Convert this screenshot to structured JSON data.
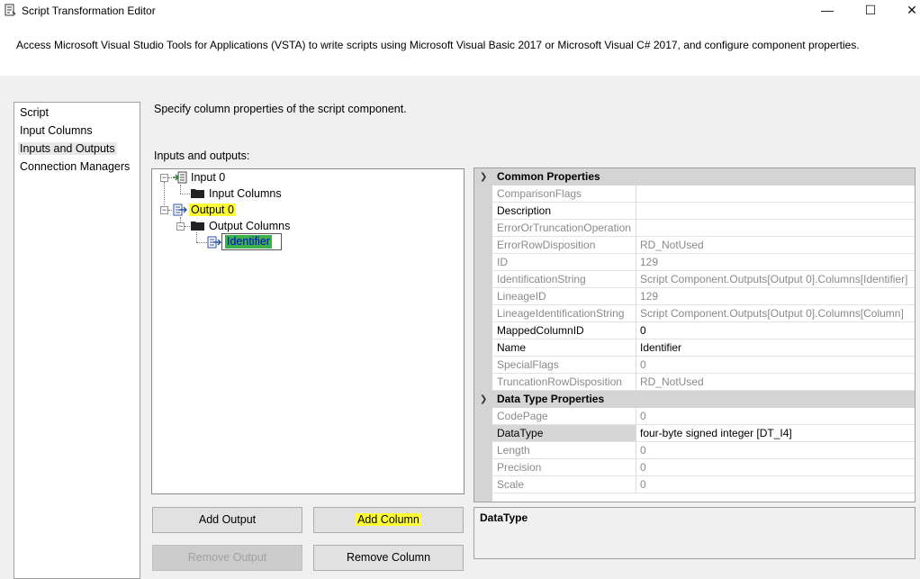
{
  "window": {
    "title": "Script Transformation Editor",
    "min_glyph": "—",
    "max_glyph": "☐",
    "close_glyph": "✕"
  },
  "header": {
    "description": "Access Microsoft Visual Studio Tools for Applications (VSTA) to write scripts using Microsoft Visual Basic 2017 or Microsoft Visual C# 2017, and configure component properties."
  },
  "nav": {
    "items": [
      "Script",
      "Input Columns",
      "Inputs and Outputs",
      "Connection Managers"
    ],
    "selected": "Inputs and Outputs"
  },
  "pane": {
    "description": "Specify column properties of the script component.",
    "io_label": "Inputs and outputs:"
  },
  "tree": {
    "input": "Input 0",
    "input_columns": "Input Columns",
    "output": "Output 0",
    "output_columns": "Output Columns",
    "editing_column": "Identifier"
  },
  "properties": {
    "common_header": "Common Properties",
    "common": [
      {
        "name": "ComparisonFlags",
        "value": "",
        "active": false
      },
      {
        "name": "Description",
        "value": "",
        "active": true
      },
      {
        "name": "ErrorOrTruncationOperation",
        "value": "",
        "active": false
      },
      {
        "name": "ErrorRowDisposition",
        "value": "RD_NotUsed",
        "active": false
      },
      {
        "name": "ID",
        "value": "129",
        "active": false
      },
      {
        "name": "IdentificationString",
        "value": "Script Component.Outputs[Output 0].Columns[Identifier]",
        "active": false
      },
      {
        "name": "LineageID",
        "value": "129",
        "active": false
      },
      {
        "name": "LineageIdentificationString",
        "value": "Script Component.Outputs[Output 0].Columns[Column]",
        "active": false
      },
      {
        "name": "MappedColumnID",
        "value": "0",
        "active": true
      },
      {
        "name": "Name",
        "value": "Identifier",
        "active": true
      },
      {
        "name": "SpecialFlags",
        "value": "0",
        "active": false
      },
      {
        "name": "TruncationRowDisposition",
        "value": "RD_NotUsed",
        "active": false
      }
    ],
    "datatype_header": "Data Type Properties",
    "datatype": [
      {
        "name": "CodePage",
        "value": "0",
        "active": false
      },
      {
        "name": "DataType",
        "value": "four-byte signed integer [DT_I4]",
        "active": true,
        "selected": true
      },
      {
        "name": "Length",
        "value": "0",
        "active": false
      },
      {
        "name": "Precision",
        "value": "0",
        "active": false
      },
      {
        "name": "Scale",
        "value": "0",
        "active": false
      }
    ]
  },
  "description_panel": {
    "title": "DataType"
  },
  "buttons": {
    "add_output": "Add Output",
    "add_column": "Add Column",
    "remove_output": "Remove Output",
    "remove_column": "Remove Column"
  }
}
